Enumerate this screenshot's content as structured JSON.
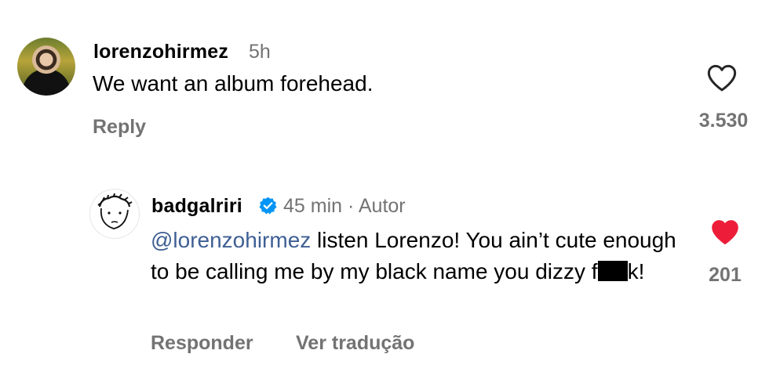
{
  "comments": [
    {
      "username": "lorenzohirmez",
      "time": "5h",
      "text": "We want an album forehead.",
      "reply_label": "Reply",
      "like_count": "3.530",
      "liked": false
    },
    {
      "username": "badgalriri",
      "verified": true,
      "time_author": "45 min · Autor",
      "mention": "@lorenzohirmez",
      "text_part1": " listen Lorenzo! You ain’t cute enough to be calling me by my black name you dizzy f",
      "text_part2": "k!",
      "reply_label": "Responder",
      "translate_label": "Ver tradução",
      "like_count": "201",
      "liked": true
    }
  ],
  "colors": {
    "secondary_text": "#737373",
    "mention": "#3f5f94",
    "liked_heart": "#ed1d3a",
    "verified_badge": "#0095f6"
  },
  "icons": {
    "heart_outline": "heart-outline-icon",
    "heart_filled": "heart-filled-icon",
    "verified": "verified-badge-icon"
  }
}
